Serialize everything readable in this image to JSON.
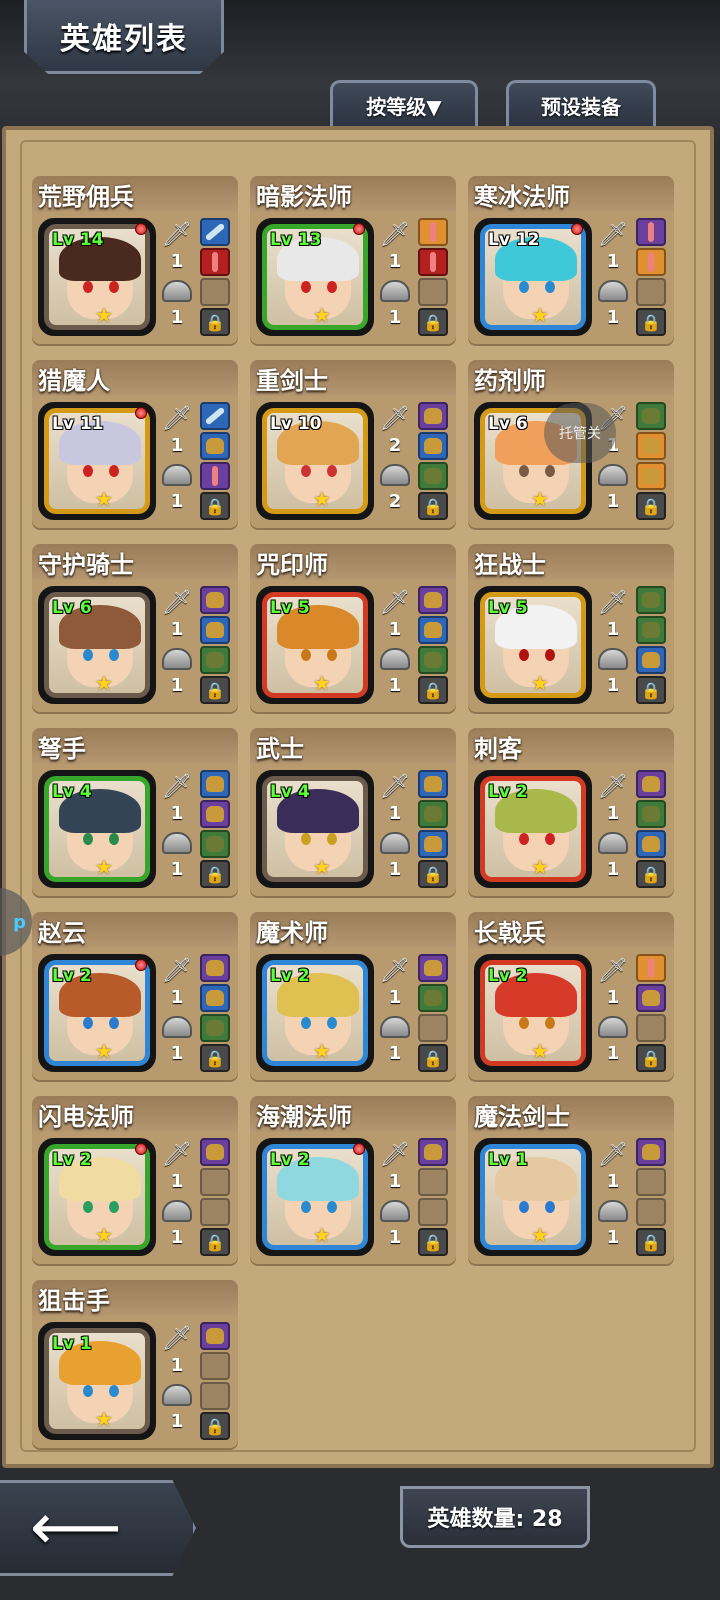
{
  "header": {
    "title": "英雄列表",
    "sort_label": "按等级▼",
    "preset_label": "预设装备"
  },
  "heroes": [
    {
      "name": "荒野佣兵",
      "level": "Lv 14",
      "atk": "1",
      "def": "1"
    },
    {
      "name": "暗影法师",
      "level": "Lv 13",
      "atk": "1",
      "def": "1"
    },
    {
      "name": "寒冰法师",
      "level": "Lv 12",
      "atk": "1",
      "def": "1"
    },
    {
      "name": "猎魔人",
      "level": "Lv 11",
      "atk": "1",
      "def": "1"
    },
    {
      "name": "重剑士",
      "level": "Lv 10",
      "atk": "2",
      "def": "2"
    },
    {
      "name": "药剂师",
      "level": "Lv 6",
      "atk": "1",
      "def": "1"
    },
    {
      "name": "守护骑士",
      "level": "Lv 6",
      "atk": "1",
      "def": "1"
    },
    {
      "name": "咒印师",
      "level": "Lv 5",
      "atk": "1",
      "def": "1"
    },
    {
      "name": "狂战士",
      "level": "Lv 5",
      "atk": "1",
      "def": "1"
    },
    {
      "name": "弩手",
      "level": "Lv 4",
      "atk": "1",
      "def": "1"
    },
    {
      "name": "武士",
      "level": "Lv 4",
      "atk": "1",
      "def": "1"
    },
    {
      "name": "刺客",
      "level": "Lv 2",
      "atk": "1",
      "def": "1"
    },
    {
      "name": "赵云",
      "level": "Lv 2",
      "atk": "1",
      "def": "1"
    },
    {
      "name": "魔术师",
      "level": "Lv 2",
      "atk": "1",
      "def": "1"
    },
    {
      "name": "长戟兵",
      "level": "Lv 2",
      "atk": "1",
      "def": "1"
    },
    {
      "name": "闪电法师",
      "level": "Lv 2",
      "atk": "1",
      "def": "1"
    },
    {
      "name": "海潮法师",
      "level": "Lv 2",
      "atk": "1",
      "def": "1"
    },
    {
      "name": "魔法剑士",
      "level": "Lv 1",
      "atk": "1",
      "def": "1"
    },
    {
      "name": "狙击手",
      "level": "Lv 1",
      "atk": "1",
      "def": "1"
    }
  ],
  "footer": {
    "hero_count": "英雄数量: 28"
  },
  "overlay": {
    "bubble_text": "托管关",
    "edge_text": "p"
  }
}
